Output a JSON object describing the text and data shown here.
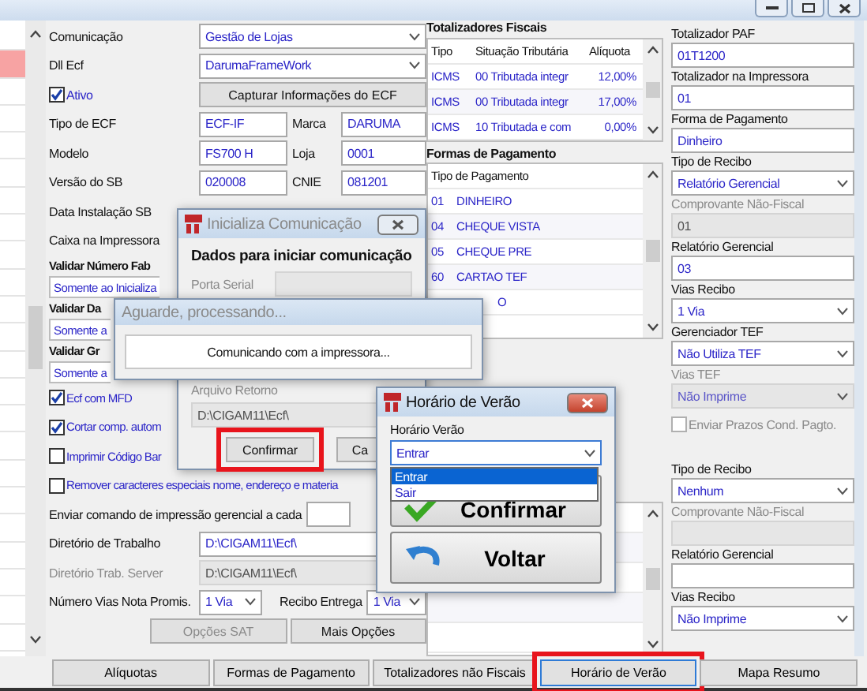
{
  "left_list": {
    "rows": [
      {
        "selected": false
      },
      {
        "selected": true
      },
      {
        "selected": false
      },
      {
        "selected": false
      },
      {
        "selected": false
      },
      {
        "selected": false
      },
      {
        "selected": false
      },
      {
        "selected": false
      },
      {
        "selected": false
      },
      {
        "selected": false
      },
      {
        "selected": false
      },
      {
        "selected": false
      },
      {
        "selected": false
      },
      {
        "selected": false
      },
      {
        "selected": false
      },
      {
        "selected": false
      },
      {
        "selected": false
      },
      {
        "selected": false
      },
      {
        "selected": false
      },
      {
        "selected": false
      },
      {
        "selected": false
      },
      {
        "selected": false
      },
      {
        "selected": false
      }
    ]
  },
  "form": {
    "rows": [
      {
        "kind": "select",
        "label": "Comunicação",
        "value": "Gestão de Lojas"
      },
      {
        "kind": "select",
        "label": "Dll Ecf",
        "value": "DarumaFrameWork"
      },
      {
        "kind": "checkbox_action",
        "label": "Ativo",
        "checked": true,
        "button": "Capturar Informações do ECF"
      },
      {
        "kind": "pair",
        "label": "Tipo de ECF",
        "value": "ECF-IF",
        "label2": "Marca",
        "value2": "DARUMA"
      },
      {
        "kind": "pair",
        "label": "Modelo",
        "value": "FS700 H",
        "label2": "Loja",
        "value2": "0001"
      },
      {
        "kind": "pair",
        "label": "Versão do SB",
        "value": "020008",
        "label2": "CNIE",
        "value2": "081201"
      },
      {
        "kind": "label",
        "label": "Data Instalação SB"
      },
      {
        "kind": "label",
        "label": "Caixa na Impressora"
      },
      {
        "kind": "heading",
        "label": "Validar Número Fab"
      },
      {
        "kind": "short_select",
        "value": "Somente ao Inicializa"
      },
      {
        "kind": "heading",
        "label": "Validar Da"
      },
      {
        "kind": "short_select",
        "value": "Somente a"
      },
      {
        "kind": "heading",
        "label": "Validar Gr"
      },
      {
        "kind": "short_select",
        "value": "Somente a"
      },
      {
        "kind": "checkbox",
        "label": "Ecf com MFD",
        "checked": true
      },
      {
        "kind": "checkbox",
        "label": "Cortar comp. autom",
        "checked": true
      },
      {
        "kind": "checkbox",
        "label": "Imprimir Código Bar",
        "checked": false
      },
      {
        "kind": "checkbox",
        "label": "Remover caracteres especiais nome, endereço e materia",
        "checked": false
      },
      {
        "kind": "inline_field",
        "label": "Enviar comando de impressão gerencial a cada"
      },
      {
        "kind": "field",
        "label": "Diretório de Trabalho",
        "value": "D:\\CIGAM11\\Ecf\\",
        "disabled": false
      },
      {
        "kind": "field",
        "label": "Diretório Trab. Server",
        "value": "D:\\CIGAM11\\Ecf\\",
        "disabled": true
      },
      {
        "kind": "two_selects",
        "label": "Número Vias Nota Promis.",
        "value": "1 Via",
        "label2": "Recibo Entrega",
        "value2": "1 Via"
      },
      {
        "kind": "buttons",
        "buttons": [
          {
            "label": "Opções SAT",
            "disabled": true
          },
          {
            "label": "Mais Opções",
            "disabled": false
          }
        ]
      }
    ]
  },
  "totalizadores_fiscais": {
    "title": "Totalizadores Fiscais",
    "columns": [
      "Tipo",
      "Situação Tributária",
      "Alíquota"
    ],
    "rows": [
      [
        "ICMS",
        "00 Tributada integr",
        "12,00%"
      ],
      [
        "ICMS",
        "00 Tributada integr",
        "17,00%"
      ],
      [
        "ICMS",
        "10 Tributada e com",
        "0,00%"
      ]
    ]
  },
  "formas_pagamento": {
    "title": "Formas de Pagamento",
    "column": "Tipo de Pagamento",
    "rows": [
      {
        "code": "01",
        "name": "DINHEIRO"
      },
      {
        "code": "04",
        "name": "CHEQUE VISTA"
      },
      {
        "code": "05",
        "name": "CHEQUE PRE"
      },
      {
        "code": "60",
        "name": "CARTAO TEF"
      },
      {
        "name": "O"
      }
    ]
  },
  "right_top": [
    {
      "kind": "field",
      "label": "Totalizador PAF",
      "value": "01T1200",
      "disabled": false
    },
    {
      "kind": "field",
      "label": "Totalizador na Impressora",
      "value": "01",
      "disabled": false
    },
    {
      "kind": "field",
      "label": "Forma de Pagamento",
      "value": "Dinheiro",
      "disabled": false
    },
    {
      "kind": "select",
      "label": "Tipo de Recibo",
      "value": "Relatório Gerencial",
      "disabled": false
    },
    {
      "kind": "field",
      "label": "Comprovante Não-Fiscal",
      "value": "01",
      "disabled": true
    },
    {
      "kind": "field",
      "label": "Relatório Gerencial",
      "value": "03",
      "disabled": false
    },
    {
      "kind": "select",
      "label": "Vias Recibo",
      "value": "1 Via",
      "disabled": false
    },
    {
      "kind": "select",
      "label": "Gerenciador TEF",
      "value": "Não Utiliza TEF",
      "disabled": false
    },
    {
      "kind": "select",
      "label": "Vias TEF",
      "value": "Não Imprime",
      "disabled": true
    },
    {
      "kind": "checkbox",
      "label": "Enviar Prazos Cond. Pagto.",
      "checked": false,
      "disabled": true
    }
  ],
  "right_bottom": [
    {
      "kind": "select",
      "label": "Tipo de Recibo",
      "value": "Nenhum",
      "disabled": false
    },
    {
      "kind": "field",
      "label": "Comprovante Não-Fiscal",
      "disabled": true
    },
    {
      "kind": "field",
      "label": "Relatório Gerencial",
      "disabled": false
    },
    {
      "kind": "select",
      "label": "Vias Recibo",
      "value": "Não Imprime",
      "disabled": false
    }
  ],
  "bottom_buttons": [
    {
      "label": "Alíquotas",
      "highlighted": false
    },
    {
      "label": "Formas de Pagamento",
      "highlighted": false
    },
    {
      "label": "Totalizadores não Fiscais",
      "highlighted": false
    },
    {
      "label": "Horário de Verão",
      "highlighted": true
    },
    {
      "label": "Mapa Resumo",
      "highlighted": false
    }
  ],
  "inicializa_dialog": {
    "title": "Inicializa Comunicação",
    "group": "Dados para iniciar comunicação",
    "porta_serial": "Porta Serial",
    "arquivo_label": "Arquivo Retorno",
    "arquivo_value": "D:\\CIGAM11\\Ecf\\",
    "buttons": [
      {
        "label": "Confirmar",
        "highlighted": true
      },
      {
        "label": "Ca",
        "highlighted": false
      }
    ]
  },
  "progress_dialog": {
    "title": "Aguarde, processando...",
    "message": "Comunicando com a impressora..."
  },
  "horario_dialog": {
    "title": "Horário de Verão",
    "label": "Horário Verão",
    "value": "Entrar",
    "options": [
      {
        "label": "Entrar",
        "selected": true
      },
      {
        "label": "Sair",
        "selected": false
      }
    ],
    "buttons": [
      {
        "kind": "confirm",
        "label": "Confirmar"
      },
      {
        "kind": "back",
        "label": "Voltar"
      }
    ]
  }
}
